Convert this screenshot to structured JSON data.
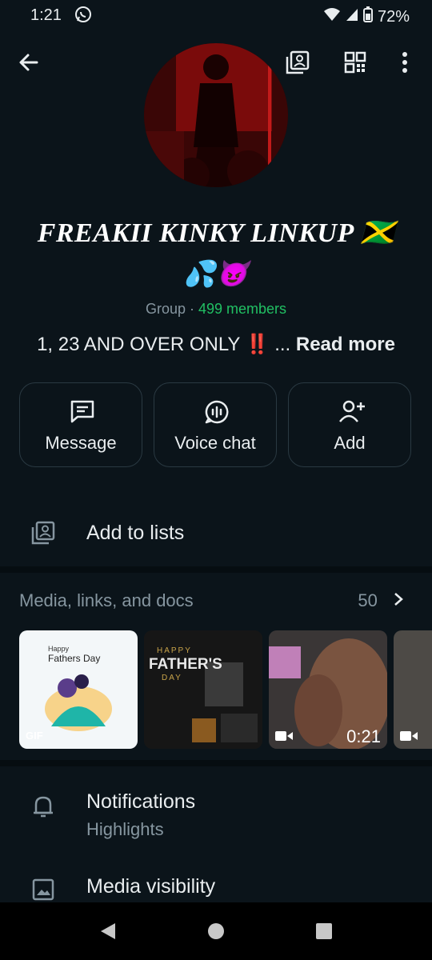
{
  "status_bar": {
    "time": "1:21",
    "battery": "72%",
    "icons": [
      "whatsapp-icon",
      "wifi-icon",
      "signal-icon",
      "battery-icon"
    ]
  },
  "top_bar": {
    "icons": [
      "back-arrow-icon",
      "add-to-list-icon",
      "qr-code-icon",
      "more-options-icon"
    ]
  },
  "group": {
    "name_line1": "FREAKII KINKY LINKUP 🇯🇲",
    "name_line2": "💦😈",
    "type": "Group",
    "separator": " · ",
    "members": "499 members",
    "description": "1, 23 AND OVER ONLY ",
    "description_emoji": "‼️",
    "ellipsis": " ... ",
    "read_more": "Read more"
  },
  "actions": [
    {
      "label": "Message",
      "icon": "message-icon"
    },
    {
      "label": "Voice chat",
      "icon": "voice-chat-icon"
    },
    {
      "label": "Add",
      "icon": "add-person-icon"
    }
  ],
  "lists_row": {
    "label": "Add to lists",
    "icon": "lists-icon"
  },
  "media": {
    "title": "Media, links, and docs",
    "count": "50",
    "thumbnails": [
      {
        "type": "gif",
        "badge": "GIF",
        "caption_small": "Happy",
        "caption": "Fathers Day"
      },
      {
        "type": "image",
        "caption_small": "HAPPY",
        "caption": "FATHER'S",
        "caption_day": "DAY"
      },
      {
        "type": "video",
        "duration": "0:21"
      },
      {
        "type": "video",
        "duration": ""
      }
    ]
  },
  "settings": [
    {
      "title": "Notifications",
      "subtitle": "Highlights",
      "icon": "bell-icon"
    },
    {
      "title": "Media visibility",
      "subtitle": "",
      "icon": "image-icon"
    }
  ],
  "colors": {
    "background": "#0b141a",
    "accent": "#21c063",
    "secondary_text": "#8696a0",
    "border": "#2a3942"
  }
}
